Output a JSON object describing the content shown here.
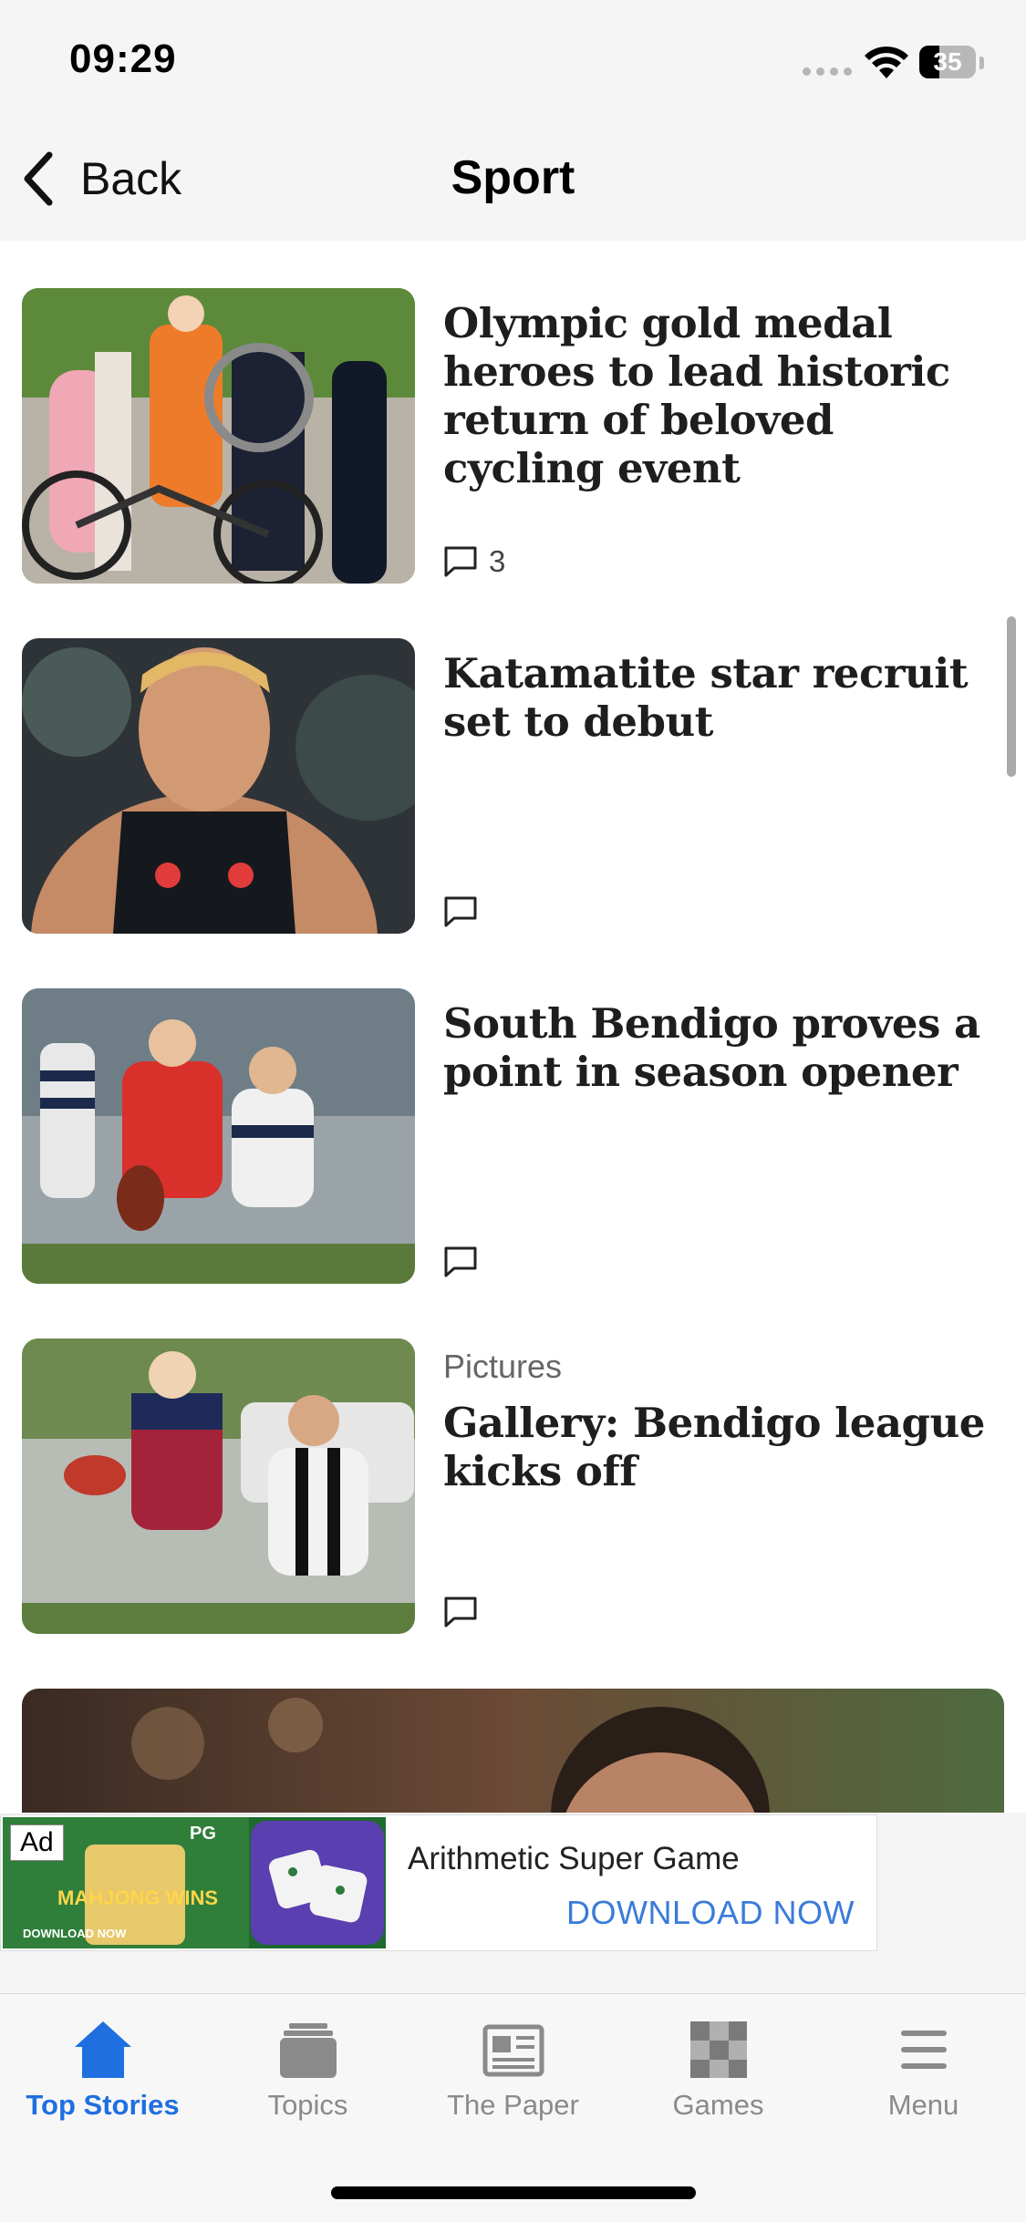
{
  "status_bar": {
    "time": "09:29",
    "battery": "35",
    "battery_level": 0.35
  },
  "nav": {
    "back_label": "Back",
    "title": "Sport"
  },
  "articles": [
    {
      "headline": "Olympic gold medal heroes to lead historic return of beloved cycling event",
      "kicker": "",
      "comments": "3"
    },
    {
      "headline": "Katamatite star recruit set to debut",
      "kicker": "",
      "comments": ""
    },
    {
      "headline": "South Bendigo proves a point in season opener",
      "kicker": "",
      "comments": ""
    },
    {
      "headline": "Gallery: Bendigo league kicks off",
      "kicker": "Pictures",
      "comments": ""
    }
  ],
  "ad": {
    "badge": "Ad",
    "image_text": {
      "top": "PG",
      "game": "MAHJONG WINS",
      "button": "DOWNLOAD NOW"
    },
    "title": "Arithmetic Super Game",
    "cta": "DOWNLOAD NOW"
  },
  "tab_bar": {
    "active": "Top Stories",
    "tabs": [
      {
        "label": "Top Stories",
        "icon": "home-icon"
      },
      {
        "label": "Topics",
        "icon": "stack-icon"
      },
      {
        "label": "The Paper",
        "icon": "newspaper-icon"
      },
      {
        "label": "Games",
        "icon": "checkerboard-icon"
      },
      {
        "label": "Menu",
        "icon": "hamburger-icon"
      }
    ]
  },
  "colors": {
    "accent": "#1f6fe0",
    "ad_cta": "#3b7bd9",
    "header_bg": "#f5f5f5"
  }
}
